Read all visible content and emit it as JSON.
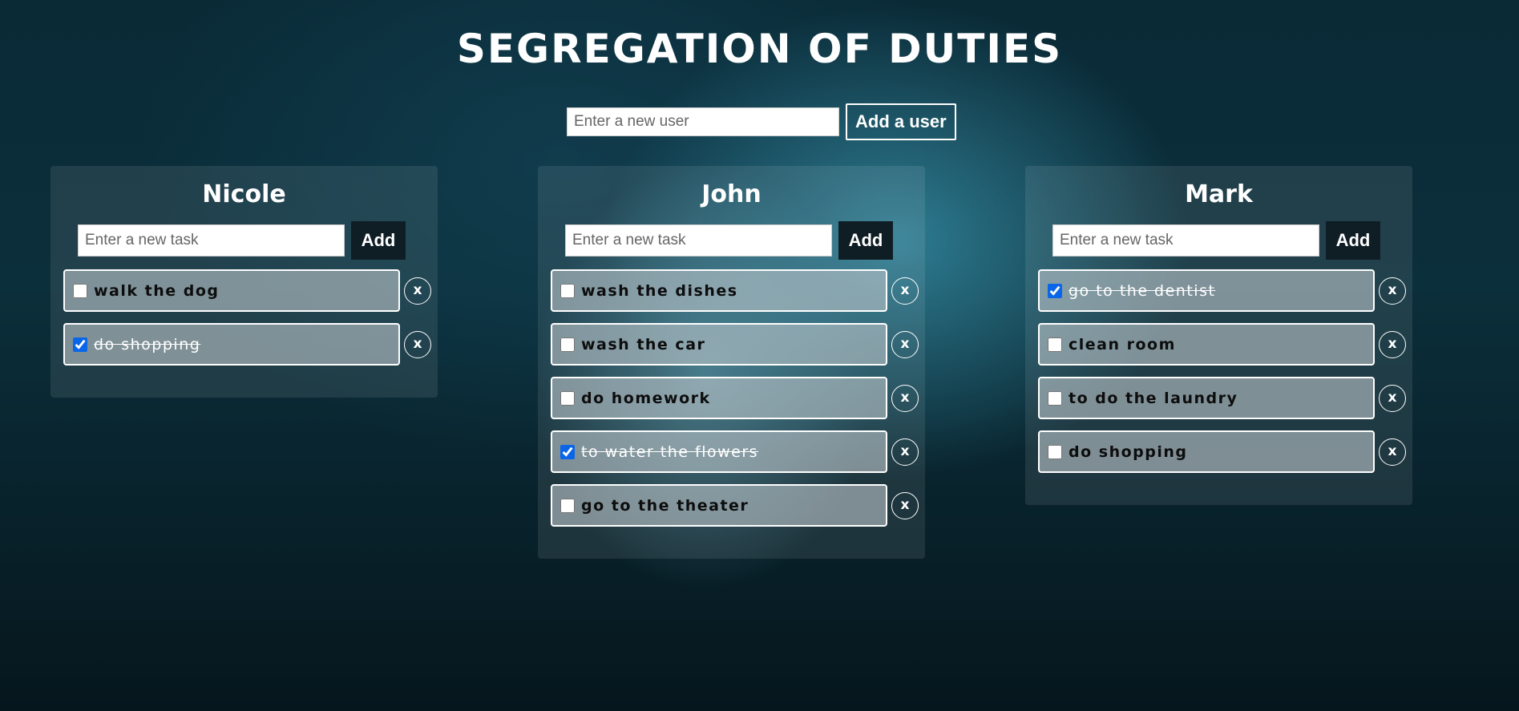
{
  "app": {
    "title": "SEGREGATION OF DUTIES",
    "user_placeholder": "Enter a new user",
    "add_user_label": "Add a user"
  },
  "cards": [
    {
      "name": "Nicole",
      "task_placeholder": "Enter a new task",
      "add_label": "Add",
      "tasks": [
        {
          "text": "walk the dog",
          "done": false
        },
        {
          "text": "do shopping",
          "done": true
        }
      ]
    },
    {
      "name": "John",
      "task_placeholder": "Enter a new task",
      "add_label": "Add",
      "tasks": [
        {
          "text": "wash the dishes",
          "done": false
        },
        {
          "text": "wash the car",
          "done": false
        },
        {
          "text": "do homework",
          "done": false
        },
        {
          "text": "to water the flowers",
          "done": true
        },
        {
          "text": "go to the theater",
          "done": false
        }
      ]
    },
    {
      "name": "Mark",
      "task_placeholder": "Enter a new task",
      "add_label": "Add",
      "tasks": [
        {
          "text": "go to the dentist",
          "done": true
        },
        {
          "text": "clean room",
          "done": false
        },
        {
          "text": "to do the laundry",
          "done": false
        },
        {
          "text": "do shopping",
          "done": false
        }
      ]
    }
  ],
  "delete_label": "x",
  "colors": {
    "accent": "#0a66e8",
    "add_button_bg": "#0f1e24"
  }
}
